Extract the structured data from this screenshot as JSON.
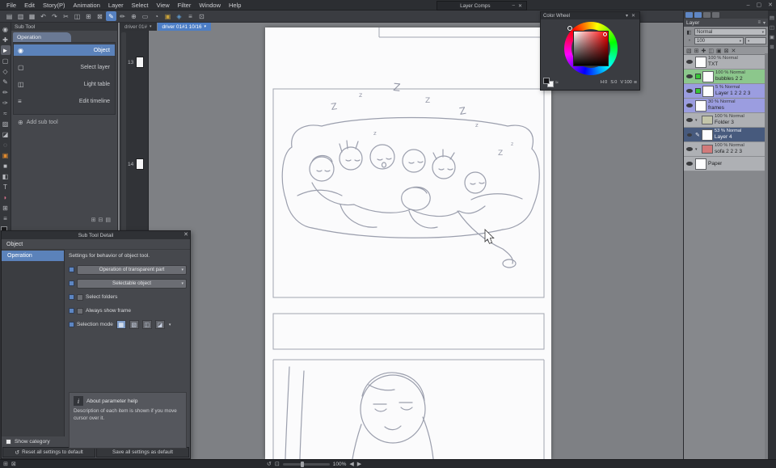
{
  "app": {
    "window_buttons": [
      {
        "g": "–",
        "name": "minimize-window-icon"
      },
      {
        "g": "▢",
        "name": "restore-window-icon"
      },
      {
        "g": "✕",
        "name": "close-window-icon"
      }
    ]
  },
  "menu": {
    "items": [
      "File",
      "Edit",
      "Story(P)",
      "Animation",
      "Layer",
      "Select",
      "View",
      "Filter",
      "Window",
      "Help"
    ]
  },
  "toolbar": {
    "icons": [
      {
        "g": "▤",
        "name": "new-file-icon"
      },
      {
        "g": "▥",
        "name": "open-file-icon"
      },
      {
        "g": "▦",
        "name": "save-icon"
      },
      {
        "g": "↶",
        "name": "undo-icon"
      },
      {
        "g": "↷",
        "name": "redo-icon"
      },
      {
        "g": "✂",
        "name": "cut-icon"
      },
      {
        "g": "◫",
        "name": "copy-icon"
      },
      {
        "g": "⊞",
        "name": "paste-icon"
      },
      {
        "g": "⊠",
        "name": "delete-icon"
      },
      {
        "g": "✎",
        "name": "snap-to-ruler-icon",
        "selected": true
      },
      {
        "g": "✏",
        "name": "snap-to-grid-icon"
      },
      {
        "g": "⊕",
        "name": "snap-special-ruler-icon"
      },
      {
        "g": "▭",
        "name": "view-fit-icon"
      },
      {
        "g": "◔",
        "name": "rotate-view-icon"
      },
      {
        "g": "▣",
        "name": "grid-icon",
        "color": "#c9a23a"
      },
      {
        "g": "◈",
        "name": "material-palette-icon",
        "color": "#5f9bd0"
      },
      {
        "g": "≡",
        "name": "command-bar-settings-icon"
      },
      {
        "g": "⊡",
        "name": "workspace-icon"
      }
    ]
  },
  "tools": {
    "icons": [
      {
        "g": "◉",
        "name": "zoom-tool"
      },
      {
        "g": "✚",
        "name": "move-tool"
      },
      {
        "g": "►",
        "name": "operation-tool",
        "selected": true
      },
      {
        "g": "▢",
        "name": "selection-tool"
      },
      {
        "g": "◇",
        "name": "lasso-tool"
      },
      {
        "g": "✎",
        "name": "pen-tool"
      },
      {
        "g": "✏",
        "name": "pencil-tool"
      },
      {
        "g": "✑",
        "name": "brush-tool"
      },
      {
        "g": "≈",
        "name": "airbrush-tool"
      },
      {
        "g": "▨",
        "name": "decoration-tool"
      },
      {
        "g": "◪",
        "name": "eraser-tool"
      },
      {
        "g": "◌",
        "name": "blend-tool"
      },
      {
        "g": "▣",
        "name": "fill-tool",
        "color": "#e08a2e"
      },
      {
        "g": "■",
        "name": "gradient-tool"
      },
      {
        "g": "◧",
        "name": "figure-tool"
      },
      {
        "g": "T",
        "name": "text-tool"
      },
      {
        "g": "◗",
        "name": "balloon-tool",
        "color": "#d8738f"
      },
      {
        "g": "⊞",
        "name": "frame-border-tool"
      },
      {
        "g": "≡",
        "name": "ruler-tool"
      }
    ]
  },
  "doc_tabs": [
    {
      "label": "driver 01#",
      "name": "doc-tab-story"
    },
    {
      "label": "driver 01#1 10/16",
      "active": true,
      "name": "doc-tab-page"
    }
  ],
  "pages": {
    "items": [
      {
        "num": "13"
      },
      {
        "num": "14"
      }
    ]
  },
  "subtool": {
    "title": "Sub Tool",
    "group_tab": "Operation",
    "items": [
      {
        "label": "Object",
        "g": "◉",
        "selected": true,
        "name": "subtool-item-object"
      },
      {
        "label": "Select layer",
        "g": "▢",
        "name": "subtool-item-select-layer"
      },
      {
        "label": "Light table",
        "g": "◫",
        "name": "subtool-item-light-table"
      },
      {
        "label": "Edit timeline",
        "g": "≡",
        "name": "subtool-item-edit-timeline"
      }
    ],
    "add_icon": "⊕",
    "add_label": "Add sub tool",
    "foot_icons": [
      {
        "g": "⊞",
        "name": "add-subtool-icon"
      },
      {
        "g": "⊟",
        "name": "delete-subtool-icon"
      },
      {
        "g": "▤",
        "name": "subtool-menu-icon"
      }
    ]
  },
  "detail": {
    "title": "Sub Tool Detail",
    "tool_label": "Object",
    "category": "Operation",
    "description": "Settings for behavior of object tool.",
    "dropdown_transparent": "Operation of transparent part",
    "dropdown_selectable": "Selectable object",
    "check_select_folders": "Select folders",
    "check_always_show_frame": "Always show frame",
    "selection_mode_label": "Selection mode",
    "selection_icons": [
      {
        "g": "▦",
        "name": "selection-mode-new-icon",
        "first": true
      },
      {
        "g": "▧",
        "name": "selection-mode-add-icon"
      },
      {
        "g": "◫",
        "name": "selection-mode-remove-icon"
      },
      {
        "g": "◪",
        "name": "selection-mode-partial-icon"
      }
    ],
    "help_title": "About parameter help",
    "help_text": "Description of each item is shown if you move cursor over it.",
    "show_category": "Show category",
    "reset_label": "Reset all settings to default",
    "save_label": "Save all settings as default"
  },
  "color_wheel": {
    "title": "Color Wheel",
    "values": [
      {
        "k": "H",
        "v": "0"
      },
      {
        "k": "S",
        "v": "0"
      },
      {
        "k": "V",
        "v": "100"
      }
    ]
  },
  "layer_comps": {
    "title": "Layer Comps"
  },
  "layers": {
    "tab_label": "Layer",
    "blend": "Normal",
    "opacity": "100",
    "toolbar_icons": [
      {
        "g": "▧",
        "name": "new-layer-icon"
      },
      {
        "g": "⊞",
        "name": "new-folder-icon"
      },
      {
        "g": "✚",
        "name": "combine-layer-icon"
      },
      {
        "g": "◫",
        "name": "transfer-layer-icon"
      },
      {
        "g": "▣",
        "name": "layer-mask-icon"
      },
      {
        "g": "⊠",
        "name": "apply-mask-icon"
      },
      {
        "g": "✕",
        "name": "delete-layer-icon"
      }
    ],
    "rows": [
      {
        "info": "100 % Normal",
        "name_text": "TXT",
        "thumb": "white",
        "name": "layer-row-txt"
      },
      {
        "info": "100 % Normal",
        "name_text": "bubbles 2 2",
        "highlight": "green",
        "swatch": "#37c837",
        "thumb": "white",
        "name": "layer-row-bubbles"
      },
      {
        "info": "5 % Normal",
        "name_text": "Layer 1 2 2 2 3",
        "highlight": "purple",
        "swatch": "#37c837",
        "thumb": "white",
        "name": "layer-row-layer1"
      },
      {
        "info": "30 % Normal",
        "name_text": "frames",
        "highlight": "purple",
        "thumb": "white",
        "name": "layer-row-frames"
      },
      {
        "info": "100 % Normal",
        "name_text": "Folder 3",
        "thumb": "folder",
        "tri": "▾",
        "name": "layer-row-folder3"
      },
      {
        "info": "53 % Normal",
        "name_text": "Layer 4",
        "highlight": "selected",
        "thumb": "white",
        "editing": true,
        "name": "layer-row-layer4"
      },
      {
        "info": "100 % Normal",
        "name_text": "sofa 2 2 2 3",
        "thumb": "folder-red",
        "tri": "▾",
        "name": "layer-row-sofa"
      },
      {
        "info": "",
        "name_text": "Paper",
        "thumb": "white",
        "name": "layer-row-paper"
      }
    ]
  },
  "rightstrip": {
    "icons": [
      {
        "g": "▤",
        "name": "navigator-tab-icon"
      },
      {
        "g": "◫",
        "name": "material-tab-icon"
      },
      {
        "g": "▣",
        "name": "history-tab-icon"
      },
      {
        "g": "⊞",
        "name": "information-tab-icon"
      }
    ]
  },
  "statusbar": {
    "left_icons": [
      {
        "g": "⊞",
        "name": "canvas-settings-icon"
      },
      {
        "g": "⊠",
        "name": "selection-info-icon"
      }
    ],
    "rotate_icon": "↺",
    "fit_icon": "⊡",
    "zoom": "100%",
    "nav_prev": "◀",
    "nav_next": "▶"
  }
}
